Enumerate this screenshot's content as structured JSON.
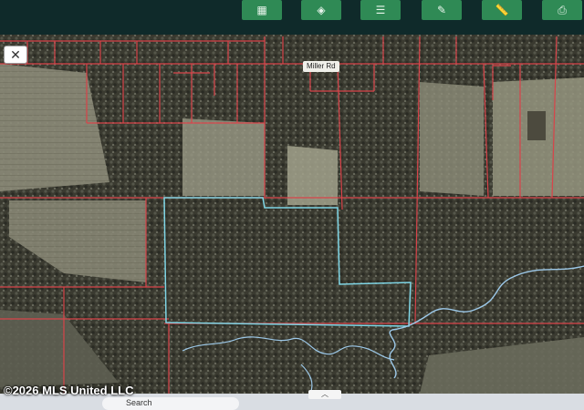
{
  "map": {
    "road_label": "Miller Rd",
    "parcel_line_color": "#d9444a",
    "subject_outline_color": "#7fd6e6",
    "creek_color": "#9cc8e8"
  },
  "toolbar": {
    "buttons": [
      {
        "icon": "grid-view-icon"
      },
      {
        "icon": "layers-icon"
      },
      {
        "icon": "list-icon"
      },
      {
        "icon": "draw-icon"
      },
      {
        "icon": "measure-icon"
      },
      {
        "icon": "print-icon"
      }
    ],
    "close_glyph": "✕"
  },
  "watermark": {
    "text": "©2026 MLS United LLC"
  },
  "taskbar": {
    "search_label": "Search",
    "chevron_glyph": "︿"
  }
}
